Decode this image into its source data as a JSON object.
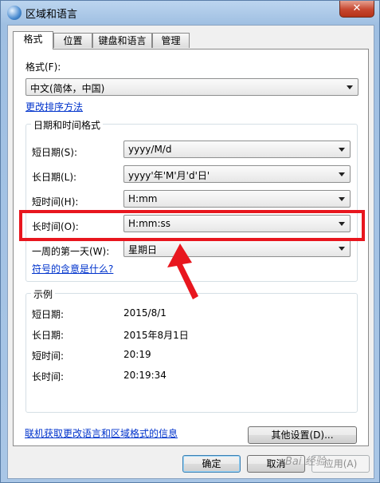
{
  "window": {
    "title": "区域和语言",
    "close_label": "✕"
  },
  "tabs": [
    {
      "label": "格式",
      "active": true
    },
    {
      "label": "位置",
      "active": false
    },
    {
      "label": "键盘和语言",
      "active": false
    },
    {
      "label": "管理",
      "active": false
    }
  ],
  "format": {
    "label": "格式(F):",
    "value": "中文(简体，中国)",
    "sort_link": "更改排序方法"
  },
  "datetime_group": {
    "title": "日期和时间格式",
    "rows": [
      {
        "label": "短日期(S):",
        "value": "yyyy/M/d"
      },
      {
        "label": "长日期(L):",
        "value": "yyyy'年'M'月'd'日'"
      },
      {
        "label": "短时间(H):",
        "value": "H:mm"
      },
      {
        "label": "长时间(O):",
        "value": "H:mm:ss"
      },
      {
        "label": "一周的第一天(W):",
        "value": "星期日"
      }
    ],
    "symbol_link": "符号的含意是什么?"
  },
  "example_group": {
    "title": "示例",
    "rows": [
      {
        "label": "短日期:",
        "value": "2015/8/1"
      },
      {
        "label": "长日期:",
        "value": "2015年8月1日"
      },
      {
        "label": "短时间:",
        "value": "20:19"
      },
      {
        "label": "长时间:",
        "value": "20:19:34"
      }
    ]
  },
  "other_settings_label": "其他设置(D)...",
  "online_link": "联机获取更改语言和区域格式的信息",
  "footer": {
    "ok": "确定",
    "cancel": "取消",
    "apply": "应用(A)"
  },
  "annotation_color": "#e8161e",
  "watermark": "Bai 经验"
}
